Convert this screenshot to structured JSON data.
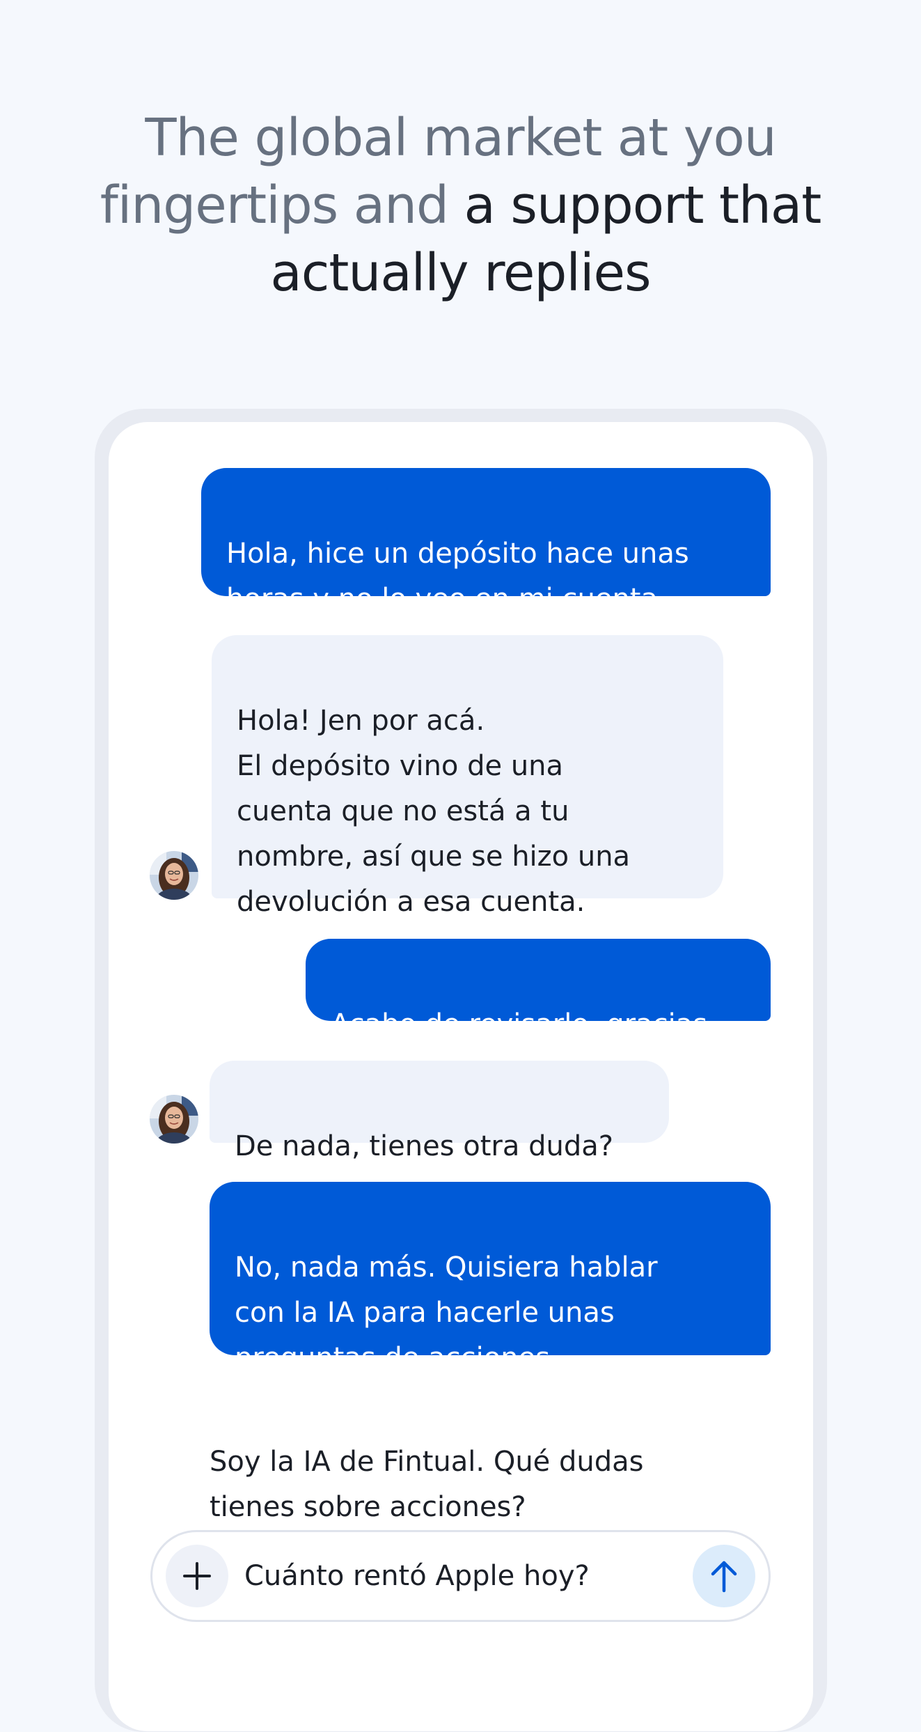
{
  "headline": {
    "line1": "The global market at you",
    "line2_muted": "fingertips and ",
    "line2_strong": "a support that",
    "line3": "actually replies"
  },
  "chat": {
    "messages": [
      {
        "sender": "user",
        "text": "Hola, hice un depósito hace unas\nhoras y no lo veo en mi cuenta."
      },
      {
        "sender": "agent",
        "text": "Hola! Jen por acá.\nEl depósito vino de una\ncuenta que no está a tu\nnombre, así que se hizo una\ndevolución a esa cuenta."
      },
      {
        "sender": "user",
        "text": "Acabo de revisarlo, gracias"
      },
      {
        "sender": "agent",
        "text": "De nada, tienes otra duda?"
      },
      {
        "sender": "user",
        "text": "No, nada más. Quisiera hablar\ncon la IA para hacerle unas\npreguntas de acciones."
      },
      {
        "sender": "ai",
        "text": "Soy la IA de Fintual. Qué dudas\ntienes sobre acciones?"
      }
    ]
  },
  "composer": {
    "value": "Cuánto rentó Apple hoy?",
    "add_icon": "plus-icon",
    "send_icon": "arrow-up-icon"
  },
  "colors": {
    "background": "#f5f8fd",
    "user_bubble": "#005ad7",
    "agent_bubble": "#eef2fa",
    "send_button": "#dcecfb",
    "muted_text": "#677180",
    "strong_text": "#1b1f27"
  }
}
